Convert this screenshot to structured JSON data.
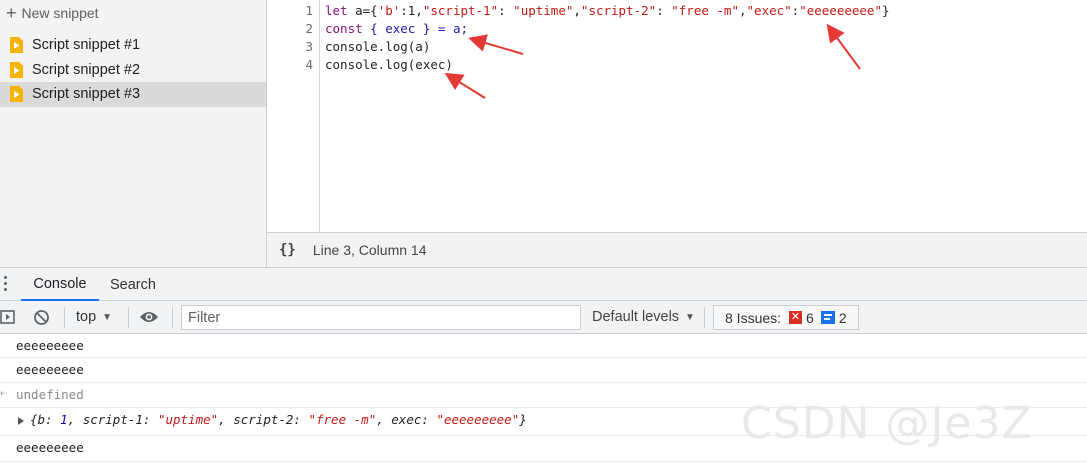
{
  "sidebar": {
    "new_snippet_label": "New snippet",
    "items": [
      {
        "label": "Script snippet #1"
      },
      {
        "label": "Script snippet #2"
      },
      {
        "label": "Script snippet #3"
      }
    ]
  },
  "editor": {
    "line_numbers": [
      "1",
      "2",
      "3",
      "4"
    ],
    "lines": {
      "l1": {
        "let": "let ",
        "a_assign": "a={",
        "b_key": "'b'",
        "b_val": ":1,",
        "k1": "\"script-1\"",
        "colon1": ": ",
        "v1": "\"uptime\"",
        "comma1": ",",
        "k2": "\"script-2\"",
        "colon2": ": ",
        "v2": "\"free -m\"",
        "comma2": ",",
        "k3": "\"exec\"",
        "colon3": ":",
        "v3": "\"eeeeeeeee\"",
        "close": "}"
      },
      "l2": {
        "const": "const ",
        "rest": "{ exec } = a;"
      },
      "l3": "console.log(a)",
      "l4": "console.log(exec)"
    }
  },
  "status_bar": {
    "format_icon": "{}",
    "position_text": "Line 3, Column 14"
  },
  "drawer": {
    "tabs": [
      {
        "label": "Console"
      },
      {
        "label": "Search"
      }
    ]
  },
  "toolbar": {
    "context": "top",
    "filter_placeholder": "Filter",
    "levels_label": "Default levels",
    "issues_label": "8 Issues:",
    "error_count": "6",
    "info_count": "2"
  },
  "console": {
    "line1": "eeeeeeeee",
    "line2": "eeeeeeeee",
    "line3": "undefined",
    "obj": {
      "open": "{b: ",
      "b_val": "1",
      "s1_key": ", script-1: ",
      "s1_val": "\"uptime\"",
      "s2_key": ", script-2: ",
      "s2_val": "\"free -m\"",
      "exec_key": ", exec: ",
      "exec_val": "\"eeeeeeeee\"",
      "close": "}"
    },
    "line5": "eeeeeeeee"
  },
  "watermark": "CSDN @Je3Z",
  "colors": {
    "keyword": "#881280",
    "string": "#c41a16",
    "number": "#1c00cf",
    "annotation_arrow": "#e53935",
    "tab_active": "#1a73e8",
    "error_badge": "#d93025",
    "info_badge": "#1a73e8",
    "snippet_icon": "#f4b400"
  }
}
